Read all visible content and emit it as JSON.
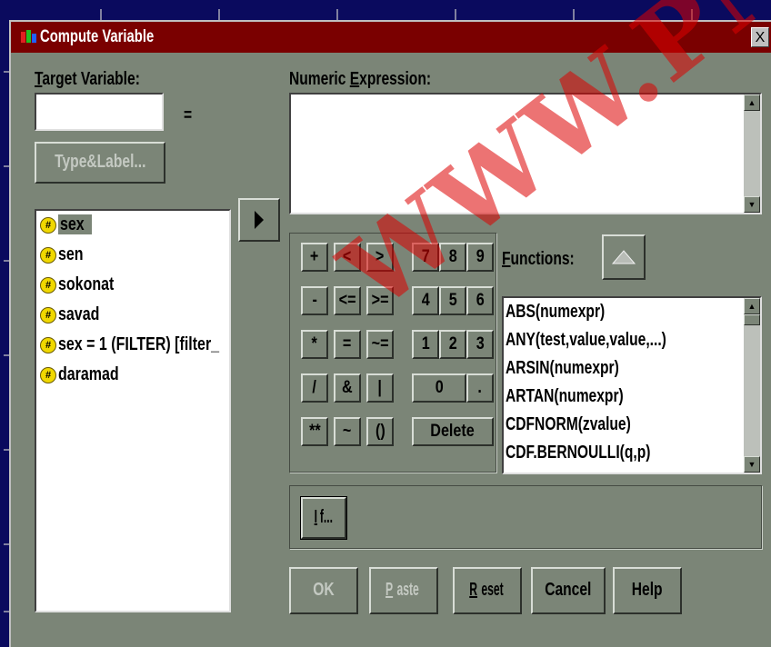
{
  "window": {
    "title": "Compute Variable",
    "close_glyph": "X"
  },
  "target": {
    "label_first": "T",
    "label_rest": "arget Variable:",
    "value": "",
    "equals": "="
  },
  "type_label_button": {
    "label": "Type&Label..."
  },
  "variables": [
    {
      "name": "sex",
      "icon": "numeric-variable-icon"
    },
    {
      "name": "sen",
      "icon": "numeric-variable-icon"
    },
    {
      "name": "sokonat",
      "icon": "numeric-variable-icon"
    },
    {
      "name": "savad",
      "icon": "numeric-variable-icon"
    },
    {
      "name": "sex = 1 (FILTER) [filter_",
      "icon": "numeric-variable-icon"
    },
    {
      "name": "daramad",
      "icon": "numeric-variable-icon"
    }
  ],
  "move_button": {
    "icon": "right-arrow-icon"
  },
  "expression": {
    "label_pre": "Numeric ",
    "label_u": "E",
    "label_rest": "xpression:",
    "value": ""
  },
  "calculator": {
    "rows": [
      [
        "+",
        "<",
        ">",
        "7",
        "8",
        "9"
      ],
      [
        "-",
        "<=",
        ">=",
        "4",
        "5",
        "6"
      ],
      [
        "*",
        "=",
        "~=",
        "1",
        "2",
        "3"
      ],
      [
        "/",
        "&",
        "|",
        "0",
        "."
      ],
      [
        "**",
        "~",
        "()",
        "Delete"
      ]
    ]
  },
  "functions": {
    "label_u": "F",
    "label_rest": "unctions:",
    "up_icon": "up-arrow-icon",
    "items": [
      "ABS(numexpr)",
      "ANY(test,value,value,...)",
      "ARSIN(numexpr)",
      "ARTAN(numexpr)",
      "CDFNORM(zvalue)",
      "CDF.BERNOULLI(q,p)"
    ]
  },
  "if_button": {
    "label_u": "I",
    "label_rest": "f..."
  },
  "buttons": {
    "ok": "OK",
    "paste_u": "P",
    "paste_rest": "aste",
    "reset_u": "R",
    "reset_rest": "eset",
    "cancel": "Cancel",
    "help": "Help"
  },
  "watermark": {
    "text": "WWW.PN"
  },
  "colors": {
    "title_bar": "#7a0000",
    "dialog_bg": "#7b8577",
    "desktop": "#00004f",
    "watermark": "#dc0000"
  }
}
